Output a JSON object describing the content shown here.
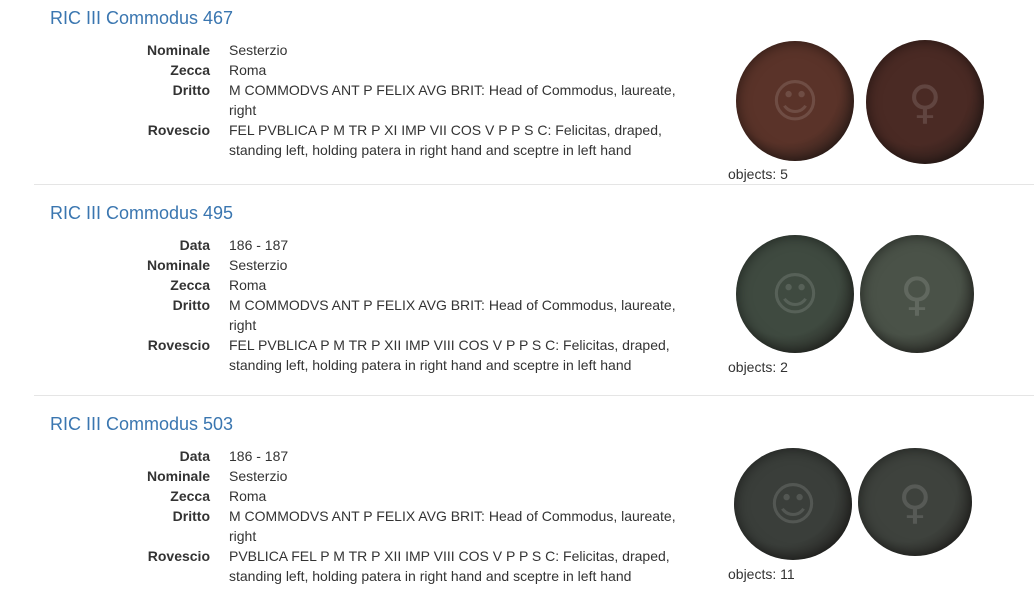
{
  "results": [
    {
      "title": "RIC III Commodus 467",
      "fields": [
        {
          "label": "Nominale",
          "value": "Sesterzio"
        },
        {
          "label": "Zecca",
          "value": "Roma"
        },
        {
          "label": "Dritto",
          "value": "M COMMODVS ANT P FELIX AVG BRIT: Head of Commodus, laureate, right"
        },
        {
          "label": "Rovescio",
          "value": "FEL PVBLICA P M TR P XI IMP VII COS V P P S C: Felicitas, draped, standing left, holding patera in right hand and sceptre in left hand"
        }
      ],
      "objects_label": "objects: 5",
      "coin_colors": [
        "#5a3329",
        "#4a2a24"
      ]
    },
    {
      "title": "RIC III Commodus 495",
      "fields": [
        {
          "label": "Data",
          "value": "186 - 187"
        },
        {
          "label": "Nominale",
          "value": "Sesterzio"
        },
        {
          "label": "Zecca",
          "value": "Roma"
        },
        {
          "label": "Dritto",
          "value": "M COMMODVS ANT P FELIX AVG BRIT: Head of Commodus, laureate, right"
        },
        {
          "label": "Rovescio",
          "value": "FEL PVBLICA P M TR P XII IMP VIII COS V P P S C: Felicitas, draped, standing left, holding patera in right hand and sceptre in left hand"
        }
      ],
      "objects_label": "objects: 2",
      "coin_colors": [
        "#3f4a40",
        "#4a5248"
      ]
    },
    {
      "title": "RIC III Commodus 503",
      "fields": [
        {
          "label": "Data",
          "value": "186 - 187"
        },
        {
          "label": "Nominale",
          "value": "Sesterzio"
        },
        {
          "label": "Zecca",
          "value": "Roma"
        },
        {
          "label": "Dritto",
          "value": "M COMMODVS ANT P FELIX AVG BRIT: Head of Commodus, laureate, right"
        },
        {
          "label": "Rovescio",
          "value": "PVBLICA FEL P M TR P XII IMP VIII COS V P P S C: Felicitas, draped, standing left, holding patera in right hand and sceptre in left hand"
        }
      ],
      "objects_label": "objects: 11",
      "coin_colors": [
        "#3a3e3a",
        "#3e423d"
      ]
    }
  ]
}
